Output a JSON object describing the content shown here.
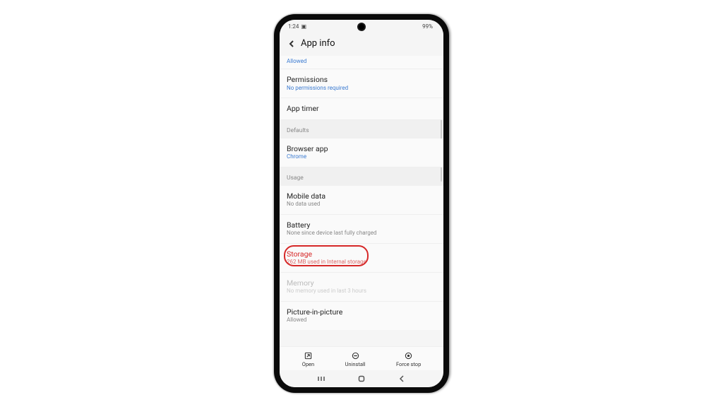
{
  "statusbar": {
    "time": "1:24",
    "camera_indicator": "▸",
    "battery_pct": "99%"
  },
  "header": {
    "title": "App info"
  },
  "allowed_label": "Allowed",
  "rows": {
    "permissions": {
      "title": "Permissions",
      "sub": "No permissions required"
    },
    "apptimer": {
      "title": "App timer"
    },
    "browser": {
      "title": "Browser app",
      "sub": "Chrome"
    },
    "mobiledata": {
      "title": "Mobile data",
      "sub": "No data used"
    },
    "battery": {
      "title": "Battery",
      "sub": "None since device last fully charged"
    },
    "storage": {
      "title": "Storage",
      "sub": "262 MB used in Internal storage"
    },
    "memory": {
      "title": "Memory",
      "sub": "No memory used in last 3 hours"
    },
    "pip": {
      "title": "Picture-in-picture",
      "sub": "Allowed"
    }
  },
  "sections": {
    "defaults": "Defaults",
    "usage": "Usage"
  },
  "actions": {
    "open": "Open",
    "uninstall": "Uninstall",
    "forcestop": "Force stop"
  }
}
